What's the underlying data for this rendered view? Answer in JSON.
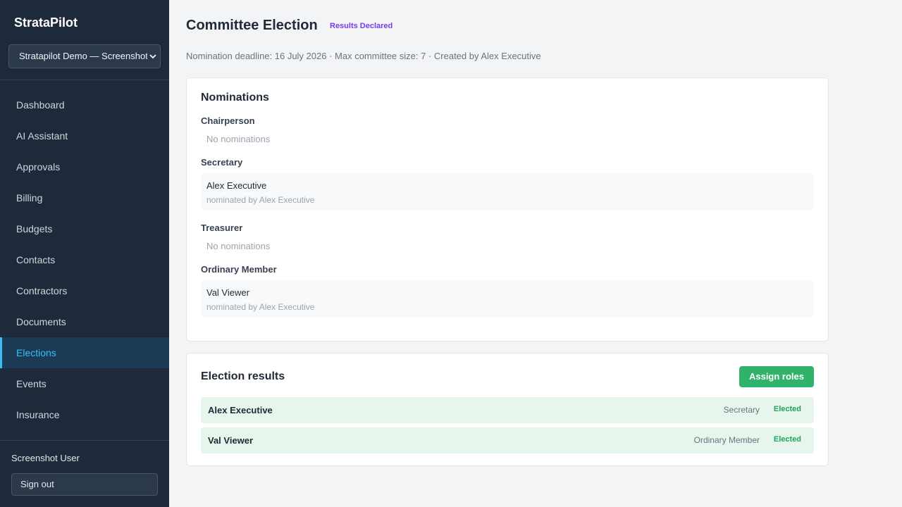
{
  "sidebar": {
    "brand": "StrataPilot",
    "org_select": "Stratapilot Demo — Screenshot",
    "nav": [
      {
        "label": "Dashboard"
      },
      {
        "label": "AI Assistant"
      },
      {
        "label": "Approvals"
      },
      {
        "label": "Billing"
      },
      {
        "label": "Budgets"
      },
      {
        "label": "Contacts"
      },
      {
        "label": "Contractors"
      },
      {
        "label": "Documents"
      },
      {
        "label": "Elections",
        "active": true
      },
      {
        "label": "Events"
      },
      {
        "label": "Insurance"
      }
    ],
    "user": "Screenshot User",
    "signout": "Sign out"
  },
  "page": {
    "title": "Committee Election",
    "status": "Results Declared",
    "meta": "Nomination deadline: 16 July 2026 · Max committee size: 7 · Created by Alex Executive"
  },
  "nominations": {
    "title": "Nominations",
    "roles": [
      {
        "role": "Chairperson",
        "empty": "No nominations"
      },
      {
        "role": "Secretary",
        "nominee": "Alex Executive",
        "nominated_by": "nominated by Alex Executive"
      },
      {
        "role": "Treasurer",
        "empty": "No nominations"
      },
      {
        "role": "Ordinary Member",
        "nominee": "Val Viewer",
        "nominated_by": "nominated by Alex Executive"
      }
    ]
  },
  "results": {
    "title": "Election results",
    "assign_button": "Assign roles",
    "rows": [
      {
        "name": "Alex Executive",
        "role": "Secretary",
        "status": "Elected"
      },
      {
        "name": "Val Viewer",
        "role": "Ordinary Member",
        "status": "Elected"
      }
    ]
  },
  "colors": {
    "sidebar_bg": "#1e2a3b",
    "active_accent": "#38bdf8",
    "status_purple": "#7c3aed",
    "success_green": "#2fb36a"
  }
}
